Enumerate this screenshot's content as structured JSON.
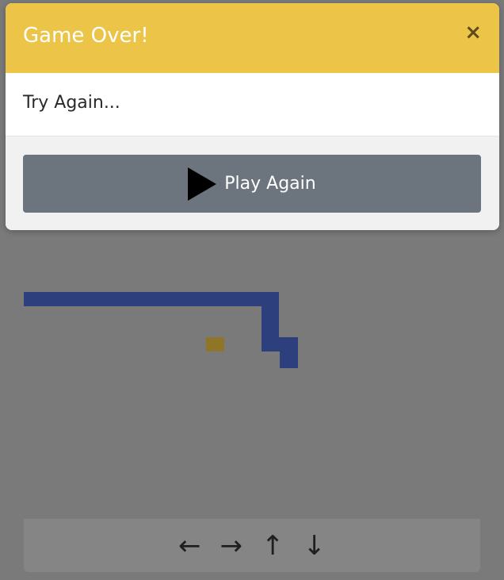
{
  "modal": {
    "title": "Game Over!",
    "close_symbol": "×",
    "message": "Try Again...",
    "play_again_label": "Play Again",
    "play_icon": "play-icon",
    "header_color": "#ecc548",
    "button_color": "#6c747e"
  },
  "controls": {
    "left": "←",
    "right": "→",
    "up": "↑",
    "down": "↓"
  },
  "colors": {
    "snake": "#2e3f7e",
    "food": "#8f7528",
    "overlay_gray": "#7a7a7a"
  }
}
